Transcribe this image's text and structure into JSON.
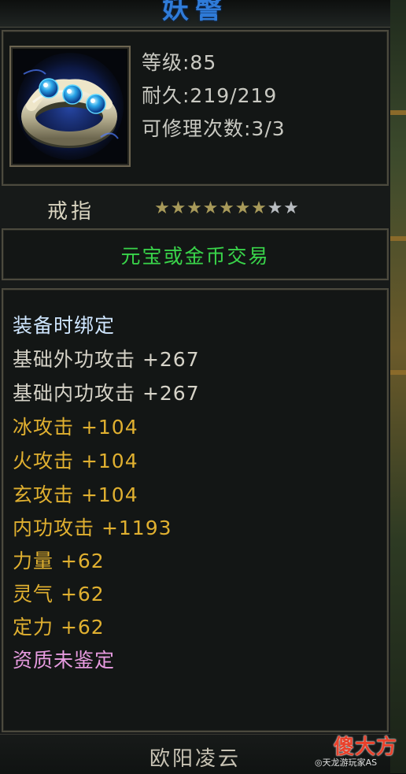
{
  "item": {
    "name": "妖謦",
    "level": "等级:85",
    "durability": "耐久:219/219",
    "repairs": "可修理次数:3/3",
    "type": "戒指",
    "stars": {
      "filled": 7,
      "total": 9,
      "filled_color": "#a89a5a",
      "empty_color": "#b8bcc0"
    },
    "trade": "元宝或金币交易"
  },
  "attributes": [
    {
      "text": "装备时绑定",
      "color": "#cfe6ff"
    },
    {
      "text": "基础外功攻击  +267",
      "color": "#d6d3c8"
    },
    {
      "text": "基础内功攻击  +267",
      "color": "#d6d3c8"
    },
    {
      "text": "冰攻击  +104",
      "color": "#e0b030"
    },
    {
      "text": "火攻击  +104",
      "color": "#e0b030"
    },
    {
      "text": "玄攻击  +104",
      "color": "#e0b030"
    },
    {
      "text": "内功攻击  +1193",
      "color": "#e0b030"
    },
    {
      "text": "力量  +62",
      "color": "#e0b030"
    },
    {
      "text": "灵气  +62",
      "color": "#e0b030"
    },
    {
      "text": "定力  +62",
      "color": "#e0b030"
    },
    {
      "text": "资质未鉴定",
      "color": "#e79be0"
    }
  ],
  "footer": {
    "owner": "欧阳凌云"
  },
  "watermark": {
    "logo": "傻大方",
    "sub": "◎天龙游玩家AS"
  },
  "icons": {
    "item_icon": "ring-icon",
    "star_icon": "star-icon"
  }
}
